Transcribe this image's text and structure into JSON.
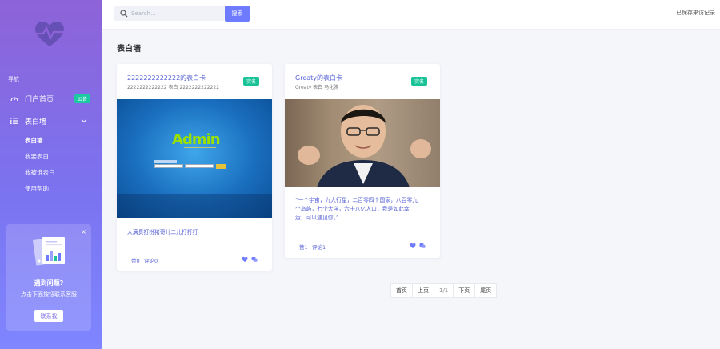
{
  "sidebar": {
    "nav_caption": "导航",
    "items": [
      {
        "label": "门户首页",
        "badge": "公告"
      },
      {
        "label": "表白墙"
      }
    ],
    "sub_items": [
      "表白墙",
      "我要表白",
      "我被谁表白",
      "使用帮助"
    ],
    "help": {
      "title": "遇到问题?",
      "subtitle": "点击下面按钮联系客服",
      "button": "联系我",
      "close": "×"
    }
  },
  "topbar": {
    "search_placeholder": "Search...",
    "search_button": "搜索",
    "visited_text": "已保存来访记录"
  },
  "main": {
    "page_title": "表白墙",
    "cards": [
      {
        "title": "2222222222222的表白卡",
        "subtitle": "2222222222222 表白 2222222222222",
        "tag": "实名",
        "message": "大满贯打扮猪哥儿二儿打打打",
        "likes": "赞0",
        "comments": "评论0",
        "image_text": "Admin"
      },
      {
        "title": "Greaty的表白卡",
        "subtitle": "Greaty 表白 马化腾",
        "tag": "实名",
        "message_lines": [
          "“一个宇宙，九大行星，二百零四个国家，八百零九",
          "个岛屿，七个大洋，六十八亿人口，我是如此幸",
          "运，可以遇见你。”"
        ],
        "likes": "赞1",
        "comments": "评论1"
      }
    ]
  },
  "pagination": {
    "first": "首页",
    "prev": "上页",
    "current": "1/1",
    "next": "下页",
    "last": "尾页"
  },
  "colors": {
    "accent": "#6f7bff",
    "sidebar_top": "#8e63d8",
    "sidebar_bottom": "#7f86ff",
    "tag": "#17c397",
    "link": "#5964d6"
  }
}
